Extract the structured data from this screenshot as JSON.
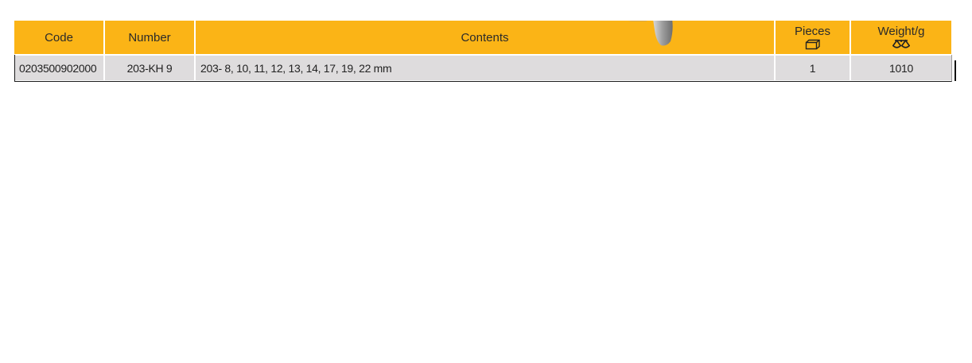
{
  "table": {
    "headers": {
      "code": "Code",
      "number": "Number",
      "contents": "Contents",
      "pieces": "Pieces",
      "weight": "Weight/g"
    },
    "icons": {
      "pieces": "box-icon",
      "weight": "scale-icon"
    },
    "rows": [
      {
        "code": "0203500902000",
        "number": "203-KH 9",
        "contents": "203- 8, 10, 11, 12, 13, 14, 17, 19, 22 mm",
        "pieces": "1",
        "weight": "1010"
      }
    ]
  },
  "colors": {
    "header_bg": "#fbb416",
    "row_bg": "#dedcdd"
  }
}
